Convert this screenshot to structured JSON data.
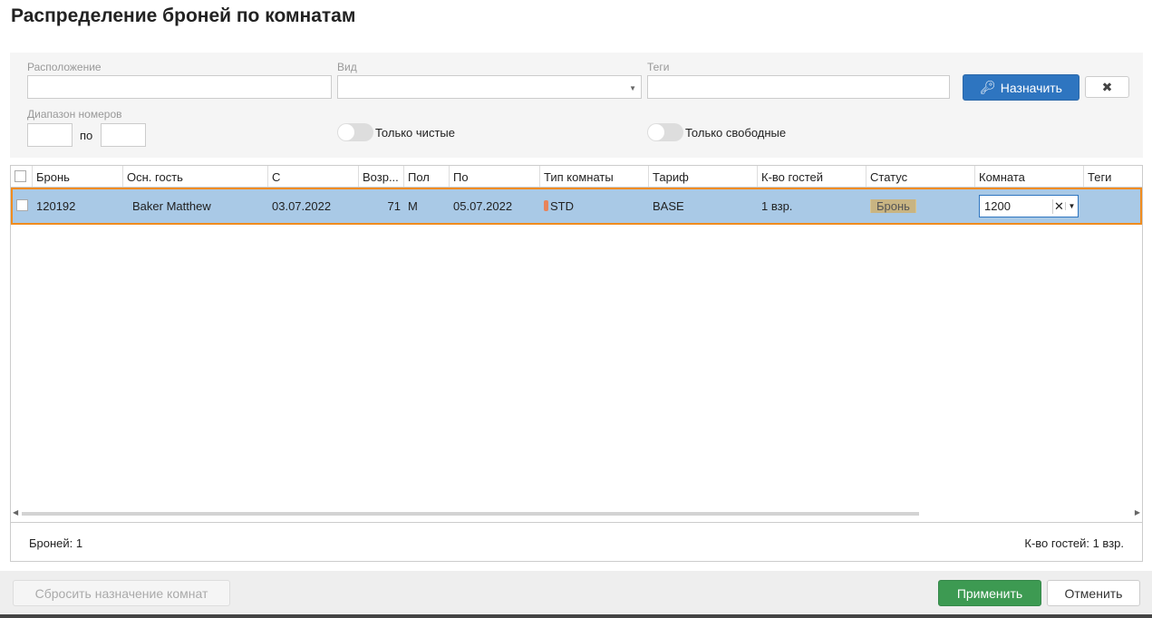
{
  "title": "Распределение броней по комнатам",
  "filters": {
    "location_label": "Расположение",
    "location_value": "",
    "view_label": "Вид",
    "view_value": "",
    "tags_label": "Теги",
    "tags_value": "",
    "range_label": "Диапазон номеров",
    "range_from": "",
    "range_sep": "по",
    "range_to": "",
    "only_clean": "Только чистые",
    "only_clean_on": false,
    "only_free": "Только свободные",
    "only_free_on": false,
    "assign_button": "Назначить",
    "clear_button": "✖"
  },
  "table": {
    "columns": [
      "Бронь",
      "Осн. гость",
      "С",
      "Возр...",
      "Пол",
      "По",
      "Тип комнаты",
      "Тариф",
      "К-во гостей",
      "Статус",
      "Комната",
      "Теги"
    ],
    "rows": [
      {
        "booking": "120192",
        "guest": "Baker Matthew",
        "from": "03.07.2022",
        "age": "71",
        "sex": "M",
        "to": "05.07.2022",
        "room_type": "STD",
        "room_type_color": "#e8835a",
        "rate": "BASE",
        "guests": "1 взр.",
        "status": "Бронь",
        "room": "1200",
        "tags": ""
      }
    ],
    "footer_left": "Броней: 1",
    "footer_right": "К-во гостей: 1 взр."
  },
  "buttons": {
    "reset": "Сбросить назначение комнат",
    "apply": "Применить",
    "cancel": "Отменить"
  },
  "colors": {
    "primary": "#2e75c0",
    "success": "#3d9a52",
    "selection": "#a9c9e6",
    "highlight": "#f08c1e"
  }
}
